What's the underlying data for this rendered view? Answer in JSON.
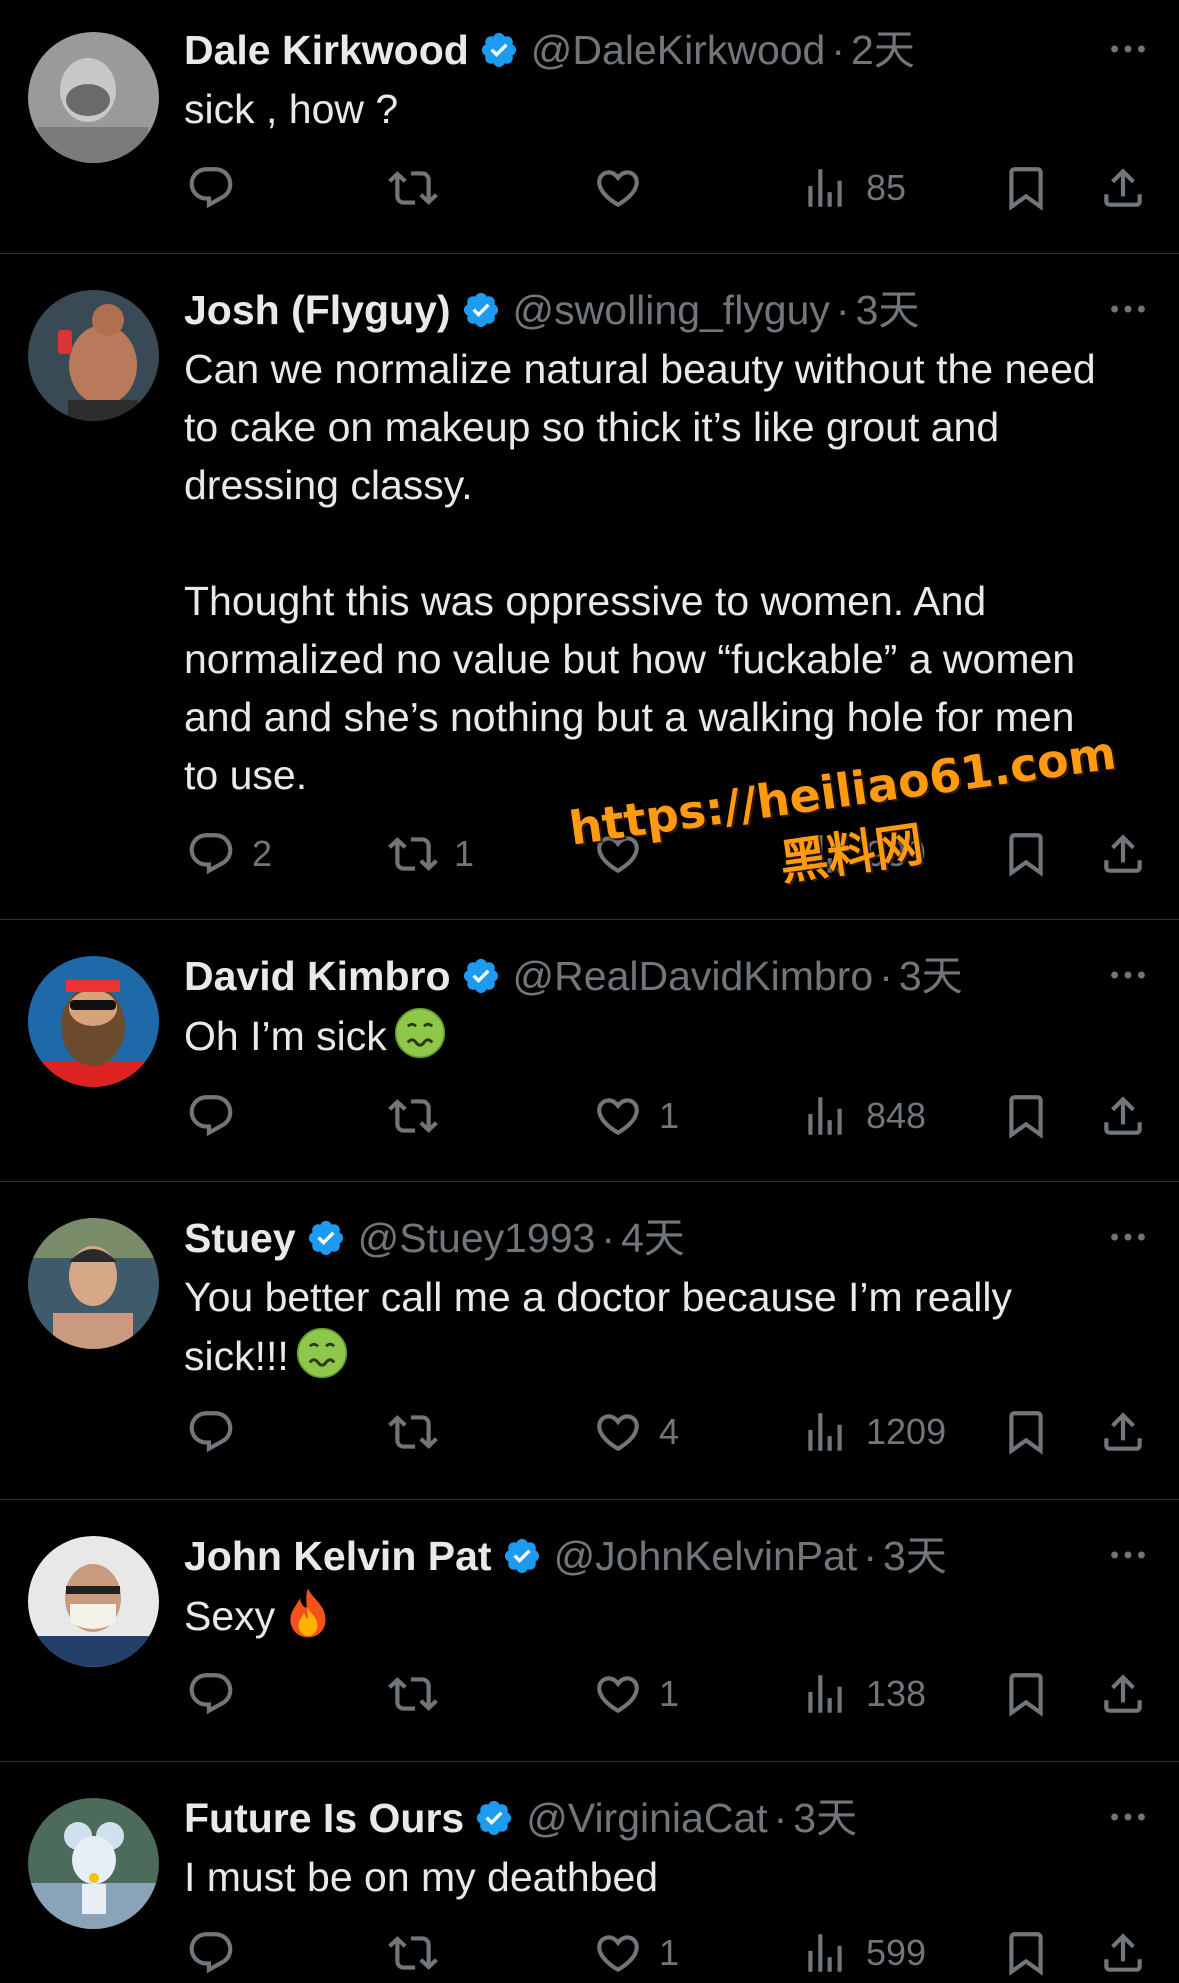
{
  "tweets": [
    {
      "name": "Dale Kirkwood",
      "handle": "@DaleKirkwood",
      "dot": "·",
      "time": "2天",
      "text": "sick , how ?",
      "reply_count": "",
      "retweet_count": "",
      "like_count": "",
      "view_count": "85"
    },
    {
      "name": "Josh (Flyguy)",
      "handle": "@swolling_flyguy",
      "dot": "·",
      "time": "3天",
      "text": "Can we normalize natural beauty without the need to cake on makeup so thick it’s like grout and dressing classy.\n\nThought this was oppressive to women. And normalized no value but how “fuckable” a women and and she’s nothing but a walking hole for men to use.",
      "reply_count": "2",
      "retweet_count": "1",
      "like_count": "",
      "view_count": "939"
    },
    {
      "name": "David Kimbro",
      "handle": "@RealDavidKimbro",
      "dot": "·",
      "time": "3天",
      "text": "Oh I’m sick",
      "emoji": "nauseated-face-icon",
      "reply_count": "",
      "retweet_count": "",
      "like_count": "1",
      "view_count": "848"
    },
    {
      "name": "Stuey",
      "handle": "@Stuey1993",
      "dot": "·",
      "time": "4天",
      "text": "You better call me a doctor because I’m really sick!!!",
      "emoji": "nauseated-face-icon",
      "reply_count": "",
      "retweet_count": "",
      "like_count": "4",
      "view_count": "1209"
    },
    {
      "name": "John Kelvin Pat",
      "handle": "@JohnKelvinPat",
      "dot": "·",
      "time": "3天",
      "text": "Sexy",
      "emoji": "fire-icon",
      "reply_count": "",
      "retweet_count": "",
      "like_count": "1",
      "view_count": "138"
    },
    {
      "name": "Future Is Ours",
      "handle": "@VirginiaCat",
      "dot": "·",
      "time": "3天",
      "text": "I must be on my deathbed",
      "reply_count": "",
      "retweet_count": "",
      "like_count": "1",
      "view_count": "599"
    }
  ],
  "watermark": {
    "url": "https://heiliao61.com",
    "cn": "黑料网"
  },
  "colors": {
    "background": "#000000",
    "text": "#e7e9ea",
    "muted": "#71767b",
    "verified": "#1d9bf0",
    "divider": "#2f3336",
    "watermark": "#ff9a12"
  }
}
